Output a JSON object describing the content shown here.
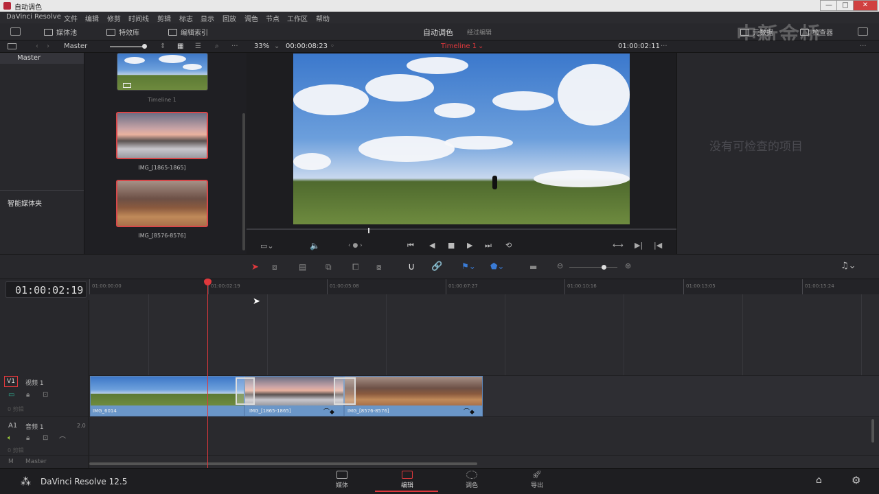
{
  "window": {
    "title": "自动调色",
    "minimize": "—",
    "maximize": "□",
    "close": "✕"
  },
  "menu": [
    "DaVinci Resolve",
    "文件",
    "编辑",
    "修剪",
    "时间线",
    "剪辑",
    "标志",
    "显示",
    "回放",
    "调色",
    "节点",
    "工作区",
    "帮助"
  ],
  "toolbar": {
    "media_pool": "媒体池",
    "effects": "特效库",
    "edit_index": "编辑索引",
    "center_title": "自动调色",
    "center_sub": "经过编辑",
    "metadata": "元数据",
    "inspector": "检查器"
  },
  "subbar": {
    "bin": "Master",
    "zoom": "33%",
    "duration": "00:00:08:23",
    "timeline_name": "Timeline 1",
    "timecode": "01:00:02:11"
  },
  "bins": {
    "master": "Master",
    "smart_bins": "智能媒体夹"
  },
  "clips": [
    {
      "name": "Timeline 1"
    },
    {
      "name": "IMG_[1865-1865]"
    },
    {
      "name": "IMG_[8576-8576]"
    }
  ],
  "inspector": {
    "empty": "没有可检查的项目"
  },
  "timeline": {
    "timecode": "01:00:02:19",
    "ruler": [
      "01:00:00:00",
      "01:00:02:19",
      "01:00:05:08",
      "01:00:07:27",
      "01:00:10:16",
      "01:00:13:05",
      "01:00:15:24"
    ],
    "v1_label": "V1",
    "v1_name": "视频 1",
    "v1_count": "0 剪辑",
    "a1_label": "A1",
    "a1_name": "音频 1",
    "a1_ch": "2.0",
    "a1_count": "0 剪辑",
    "m_label": "M",
    "m_name": "Master",
    "clip_names": [
      "IMG_6014",
      "IMG_[1865-1865]",
      "IMG_[8576-8576]"
    ]
  },
  "pages": [
    {
      "label": "媒体",
      "icon": "media-page-icon"
    },
    {
      "label": "编辑",
      "icon": "edit-page-icon"
    },
    {
      "label": "调色",
      "icon": "color-page-icon"
    },
    {
      "label": "导出",
      "icon": "deliver-page-icon"
    }
  ],
  "app_name": "DaVinci Resolve 12.5",
  "watermark": "中新金桥",
  "colors": {
    "playhead": "#e0383c",
    "accent_red": "#e0383c",
    "clip_blue": "#6a96c8",
    "clip_blue_dark": "#4d78a8",
    "selection": "#d8484a"
  }
}
